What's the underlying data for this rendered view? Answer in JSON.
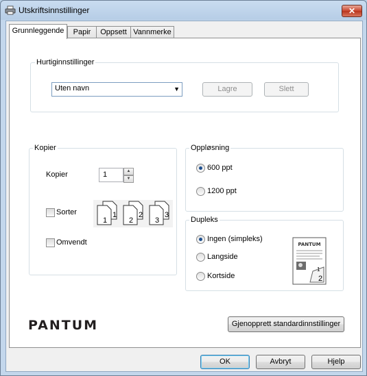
{
  "window": {
    "title": "Utskriftsinnstillinger",
    "close_glyph": "✕"
  },
  "tabs": [
    {
      "label": "Grunnleggende",
      "active": true
    },
    {
      "label": "Papir",
      "active": false
    },
    {
      "label": "Oppsett",
      "active": false
    },
    {
      "label": "Vannmerke",
      "active": false
    }
  ],
  "quick_settings": {
    "legend": "Hurtiginnstillinger",
    "selected": "Uten navn",
    "save_label": "Lagre",
    "delete_label": "Slett"
  },
  "copies": {
    "legend": "Kopier",
    "label": "Kopier",
    "value": "1",
    "collate_label": "Sorter",
    "collate_checked": false,
    "reverse_label": "Omvendt",
    "reverse_checked": false,
    "collate_sets": [
      [
        "1",
        "1"
      ],
      [
        "2",
        "2"
      ],
      [
        "3",
        "3"
      ]
    ]
  },
  "resolution": {
    "legend": "Oppløsning",
    "options": [
      {
        "label": "600 ppt",
        "selected": true
      },
      {
        "label": "1200 ppt",
        "selected": false
      }
    ]
  },
  "duplex": {
    "legend": "Dupleks",
    "options": [
      {
        "label": "Ingen (simpleks)",
        "selected": true
      },
      {
        "label": "Langside",
        "selected": false
      },
      {
        "label": "Kortside",
        "selected": false
      }
    ],
    "preview_logo": "PANTUM",
    "preview_page_1": "1",
    "preview_page_2": "2"
  },
  "brand": {
    "logo_text": "PANTUM"
  },
  "restore_defaults_label": "Gjenopprett standardinnstillinger",
  "footer": {
    "ok_label": "OK",
    "cancel_label": "Avbryt",
    "help_label": "Hjelp"
  }
}
